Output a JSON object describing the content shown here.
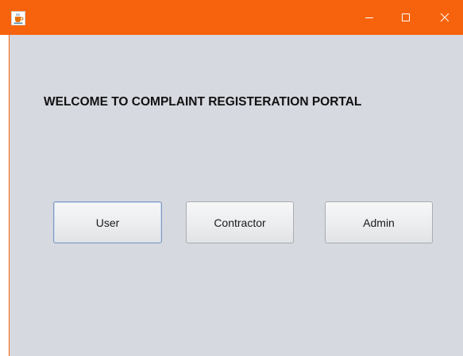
{
  "window": {
    "title_bar_color": "#f7630c",
    "app_icon": "java-coffee-icon",
    "controls": {
      "minimize_icon": "minimize-icon",
      "maximize_icon": "maximize-icon",
      "close_icon": "close-icon"
    }
  },
  "main": {
    "heading": "WELCOME TO COMPLAINT REGISTERATION PORTAL",
    "background_color": "#d7d9e0",
    "buttons": {
      "user_label": "User",
      "contractor_label": "Contractor",
      "admin_label": "Admin"
    }
  }
}
